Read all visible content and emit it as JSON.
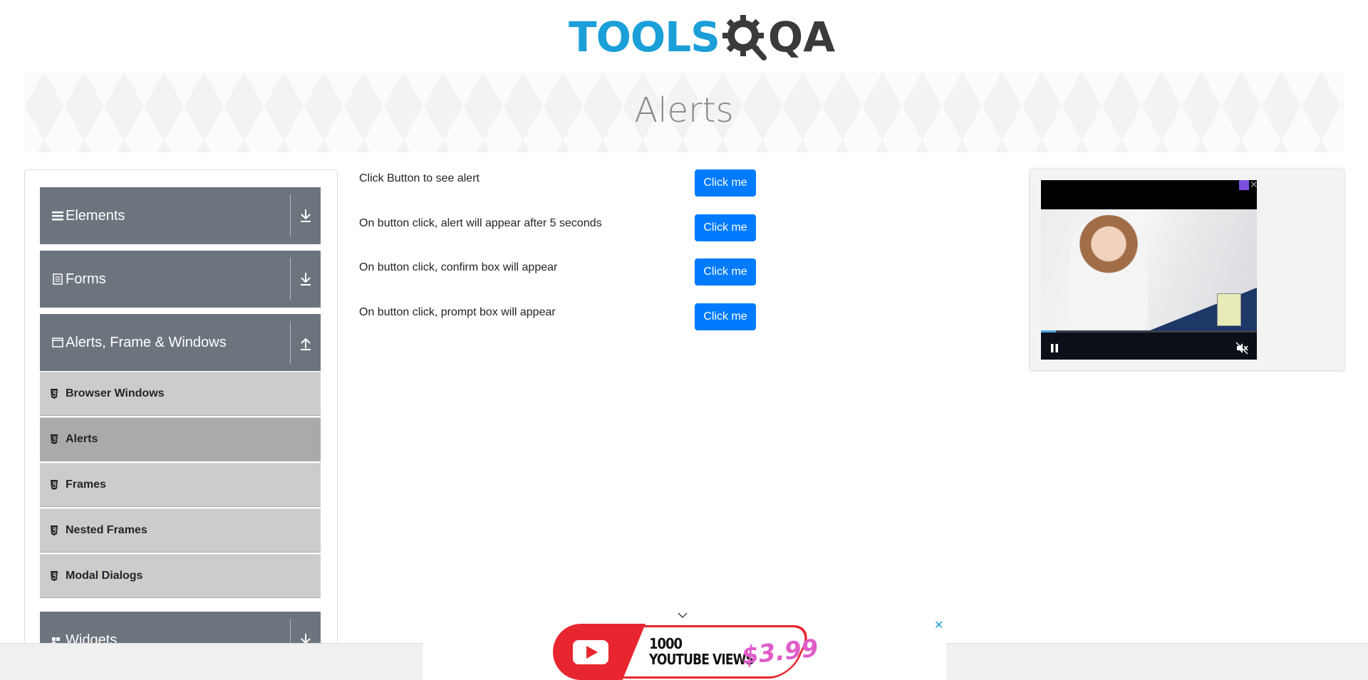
{
  "header": {
    "logo_text": "TOOLS",
    "logo_suffix": "QA"
  },
  "banner": {
    "title": "Alerts"
  },
  "sidebar": {
    "groups": [
      {
        "label": "Elements",
        "icon": "hamburger-icon",
        "expanded": false
      },
      {
        "label": "Forms",
        "icon": "form-icon",
        "expanded": false
      },
      {
        "label": "Alerts, Frame & Windows",
        "icon": "window-icon",
        "expanded": true
      },
      {
        "label": "Widgets",
        "icon": "widget-icon",
        "expanded": false
      }
    ],
    "items": [
      {
        "label": "Browser Windows",
        "active": false
      },
      {
        "label": "Alerts",
        "active": true
      },
      {
        "label": "Frames",
        "active": false
      },
      {
        "label": "Nested Frames",
        "active": false
      },
      {
        "label": "Modal Dialogs",
        "active": false
      }
    ]
  },
  "main": {
    "rows": [
      {
        "text": "Click Button to see alert",
        "button": "Click me"
      },
      {
        "text": "On button click, alert will appear after 5 seconds",
        "button": "Click me"
      },
      {
        "text": "On button click, confirm box will appear",
        "button": "Click me"
      },
      {
        "text": "On button click, prompt box will appear",
        "button": "Click me"
      }
    ]
  },
  "video_ad": {
    "progress": 0.07
  },
  "bottom_ad": {
    "line1": "1000",
    "line2": "YOUTUBE VIEWS",
    "price": "$3.99"
  },
  "colors": {
    "accent": "#007bff",
    "sidebar_group": "#6c757d",
    "sidebar_item": "#cccccc",
    "sidebar_item_active": "#aaaaaa",
    "logo_blue": "#1a9fd8"
  }
}
